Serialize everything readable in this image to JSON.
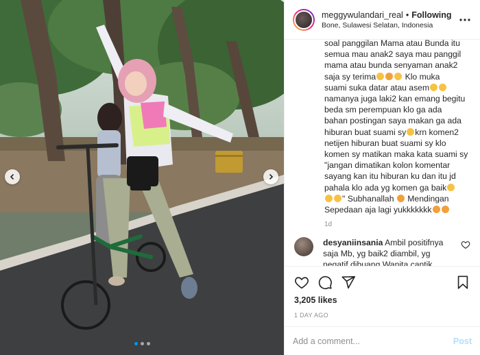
{
  "header": {
    "username": "meggywulandari_real",
    "separator": "•",
    "follow_label": "Following",
    "location": "Bone, Sulawesi Selatan, Indonesia"
  },
  "caption": {
    "lines": [
      "soal panggilan Mama atau Bunda itu",
      "semua mau anak2 saya mau panggil",
      "mama atau bunda senyaman anak2",
      "saja sy terima",
      "Klo muka",
      "suami suka datar atau asem",
      "namanya juga laki2 kan emang begitu",
      "beda sm perempuan klo ga ada",
      "bahan postingan saya makan ga ada",
      "hiburan buat suami sy",
      "krn komen2",
      "netijen hiburan buat suami sy klo",
      "komen sy matikan maka kata suami sy",
      "\"jangan dimatikan kolon komentar",
      "sayang kan itu hiburan ku dan itu jd",
      "pahala klo ada yg komen ga baik",
      "\" Subhanallah",
      "Mendingan",
      "Sepedaan aja lagi yukkkkkkk"
    ],
    "time": "1d"
  },
  "comment": {
    "username": "desyaniinsania",
    "text_lines": [
      "Ambil positifnya",
      "saja Mb, yg baik2 diambil, yg",
      "negatif dibuang Wanita cantik"
    ]
  },
  "actions": {
    "likes": "3,205 likes",
    "posted_ago": "1 DAY AGO"
  },
  "add_comment": {
    "placeholder": "Add a comment...",
    "post_label": "Post"
  },
  "carousel": {
    "slide_count": 3,
    "active_index": 0
  },
  "colors": {
    "link_blue": "#0095f6",
    "post_disabled": "#b2dffc",
    "text": "#262626",
    "muted": "#8e8e8e"
  }
}
